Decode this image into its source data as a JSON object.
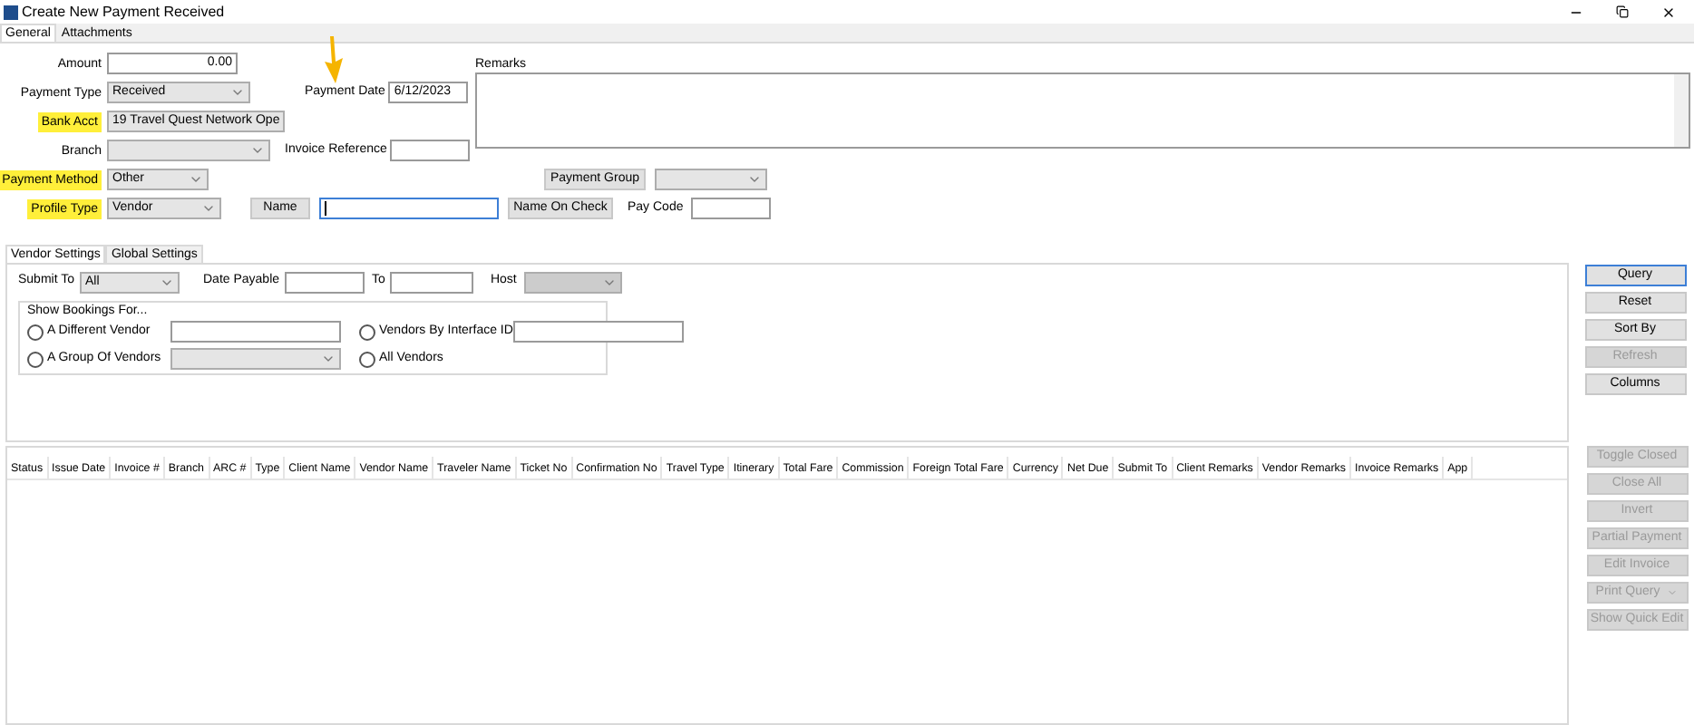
{
  "window": {
    "title": "Create New Payment Received"
  },
  "tabs": [
    {
      "label": "General",
      "selected": true
    },
    {
      "label": "Attachments",
      "selected": false
    }
  ],
  "amount": {
    "label": "Amount",
    "value": "0.00",
    "highlighted": false
  },
  "payment_type": {
    "label": "Payment Type",
    "value": "Received",
    "highlighted": false
  },
  "payment_date": {
    "label": "Payment Date",
    "value": "6/12/2023"
  },
  "bank_acct": {
    "label": "Bank Acct",
    "value": "19 Travel Quest Network Ope",
    "highlighted": true
  },
  "branch": {
    "label": "Branch",
    "highlighted": false
  },
  "invoice_reference": {
    "label": "Invoice Reference"
  },
  "remarks": {
    "label": "Remarks"
  },
  "payment_method": {
    "label": "Payment Method",
    "value": "Other",
    "highlighted": true
  },
  "payment_group": {
    "button": "Payment Group"
  },
  "profile_type": {
    "label": "Profile Type",
    "value": "Vendor",
    "highlighted": true
  },
  "name": {
    "button": "Name",
    "focused": true
  },
  "name_on_check": {
    "button": "Name On Check"
  },
  "pay_code": {
    "label": "Pay Code"
  },
  "sub_tabs": [
    {
      "label": "Vendor Settings",
      "selected": true
    },
    {
      "label": "Global Settings",
      "selected": false
    }
  ],
  "vendor_settings": {
    "submit_to": {
      "label": "Submit To",
      "value": "All"
    },
    "date_payable": {
      "label": "Date Payable"
    },
    "to": {
      "label": "To"
    },
    "host": {
      "label": "Host",
      "disabled": true
    },
    "group_title": "Show Bookings For...",
    "options": [
      {
        "label": "A Different Vendor",
        "selected": false,
        "kind": "input"
      },
      {
        "label": "Vendors By Interface ID",
        "selected": false,
        "kind": "input"
      },
      {
        "label": "A Group Of Vendors",
        "selected": false,
        "kind": "select"
      },
      {
        "label": "All Vendors",
        "selected": false,
        "kind": "none"
      }
    ]
  },
  "query_buttons": [
    {
      "label": "Query",
      "disabled": false,
      "focused": true
    },
    {
      "label": "Reset",
      "disabled": false,
      "focused": false
    },
    {
      "label": "Sort By",
      "disabled": false,
      "focused": false
    },
    {
      "label": "Refresh",
      "disabled": true,
      "focused": false
    },
    {
      "label": "Columns",
      "disabled": false,
      "focused": false
    }
  ],
  "table": {
    "columns": [
      "Status",
      "Issue Date",
      "Invoice #",
      "Branch",
      "ARC #",
      "Type",
      "Client Name",
      "Vendor Name",
      "Traveler Name",
      "Ticket No",
      "Confirmation No",
      "Travel Type",
      "Itinerary",
      "Total Fare",
      "Commission",
      "Foreign Total Fare",
      "Currency",
      "Net Due",
      "Submit To",
      "Client Remarks",
      "Vendor Remarks",
      "Invoice Remarks",
      "App"
    ]
  },
  "action_buttons": [
    {
      "label": "Toggle Closed",
      "disabled": true,
      "dropdown": false
    },
    {
      "label": "Close All",
      "disabled": true,
      "dropdown": false
    },
    {
      "label": "Invert",
      "disabled": true,
      "dropdown": false
    },
    {
      "label": "Partial Payment",
      "disabled": true,
      "dropdown": false
    },
    {
      "label": "Edit Invoice",
      "disabled": true,
      "dropdown": false
    },
    {
      "label": "Print Query",
      "disabled": true,
      "dropdown": true
    },
    {
      "label": "Show Quick Edit",
      "disabled": true,
      "dropdown": false
    }
  ]
}
